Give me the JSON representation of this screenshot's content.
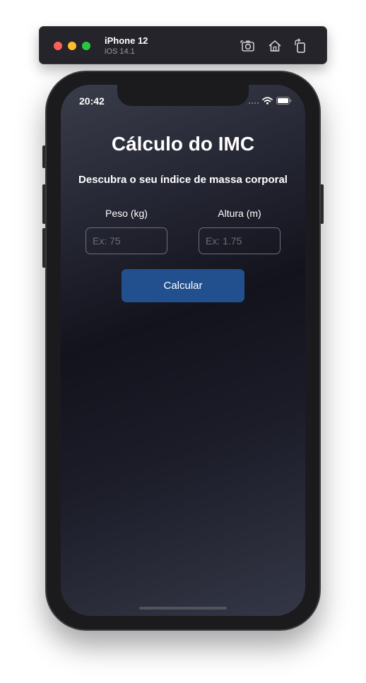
{
  "simulator": {
    "device_name": "iPhone 12",
    "os_version": "iOS 14.1",
    "toolbar_icons": [
      "screenshot-icon",
      "home-icon",
      "rotate-icon"
    ]
  },
  "status_bar": {
    "time": "20:42",
    "icons": [
      "signal-icon",
      "wifi-icon",
      "battery-icon"
    ]
  },
  "app": {
    "title": "Cálculo do IMC",
    "subtitle": "Descubra o seu índice de massa corporal",
    "fields": [
      {
        "label": "Peso (kg)",
        "placeholder": "Ex: 75",
        "value": ""
      },
      {
        "label": "Altura (m)",
        "placeholder": "Ex: 1.75",
        "value": ""
      }
    ],
    "button_label": "Calcular"
  },
  "colors": {
    "button": "#22508f",
    "background_top": "#393c4a",
    "background_mid": "#13131d",
    "background_bottom": "#343746",
    "close": "#ff5f57",
    "minimize": "#febc2e",
    "maximize": "#28c840"
  }
}
